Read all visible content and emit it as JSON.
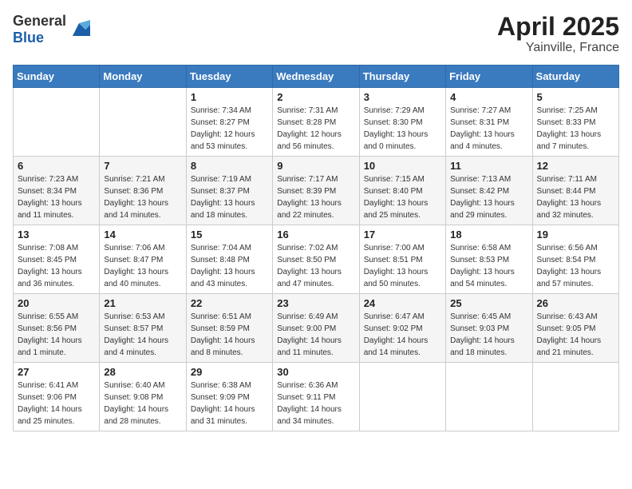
{
  "header": {
    "logo_general": "General",
    "logo_blue": "Blue",
    "month": "April 2025",
    "location": "Yainville, France"
  },
  "calendar": {
    "weekdays": [
      "Sunday",
      "Monday",
      "Tuesday",
      "Wednesday",
      "Thursday",
      "Friday",
      "Saturday"
    ],
    "weeks": [
      [
        {
          "day": "",
          "info": ""
        },
        {
          "day": "",
          "info": ""
        },
        {
          "day": "1",
          "info": "Sunrise: 7:34 AM\nSunset: 8:27 PM\nDaylight: 12 hours and 53 minutes."
        },
        {
          "day": "2",
          "info": "Sunrise: 7:31 AM\nSunset: 8:28 PM\nDaylight: 12 hours and 56 minutes."
        },
        {
          "day": "3",
          "info": "Sunrise: 7:29 AM\nSunset: 8:30 PM\nDaylight: 13 hours and 0 minutes."
        },
        {
          "day": "4",
          "info": "Sunrise: 7:27 AM\nSunset: 8:31 PM\nDaylight: 13 hours and 4 minutes."
        },
        {
          "day": "5",
          "info": "Sunrise: 7:25 AM\nSunset: 8:33 PM\nDaylight: 13 hours and 7 minutes."
        }
      ],
      [
        {
          "day": "6",
          "info": "Sunrise: 7:23 AM\nSunset: 8:34 PM\nDaylight: 13 hours and 11 minutes."
        },
        {
          "day": "7",
          "info": "Sunrise: 7:21 AM\nSunset: 8:36 PM\nDaylight: 13 hours and 14 minutes."
        },
        {
          "day": "8",
          "info": "Sunrise: 7:19 AM\nSunset: 8:37 PM\nDaylight: 13 hours and 18 minutes."
        },
        {
          "day": "9",
          "info": "Sunrise: 7:17 AM\nSunset: 8:39 PM\nDaylight: 13 hours and 22 minutes."
        },
        {
          "day": "10",
          "info": "Sunrise: 7:15 AM\nSunset: 8:40 PM\nDaylight: 13 hours and 25 minutes."
        },
        {
          "day": "11",
          "info": "Sunrise: 7:13 AM\nSunset: 8:42 PM\nDaylight: 13 hours and 29 minutes."
        },
        {
          "day": "12",
          "info": "Sunrise: 7:11 AM\nSunset: 8:44 PM\nDaylight: 13 hours and 32 minutes."
        }
      ],
      [
        {
          "day": "13",
          "info": "Sunrise: 7:08 AM\nSunset: 8:45 PM\nDaylight: 13 hours and 36 minutes."
        },
        {
          "day": "14",
          "info": "Sunrise: 7:06 AM\nSunset: 8:47 PM\nDaylight: 13 hours and 40 minutes."
        },
        {
          "day": "15",
          "info": "Sunrise: 7:04 AM\nSunset: 8:48 PM\nDaylight: 13 hours and 43 minutes."
        },
        {
          "day": "16",
          "info": "Sunrise: 7:02 AM\nSunset: 8:50 PM\nDaylight: 13 hours and 47 minutes."
        },
        {
          "day": "17",
          "info": "Sunrise: 7:00 AM\nSunset: 8:51 PM\nDaylight: 13 hours and 50 minutes."
        },
        {
          "day": "18",
          "info": "Sunrise: 6:58 AM\nSunset: 8:53 PM\nDaylight: 13 hours and 54 minutes."
        },
        {
          "day": "19",
          "info": "Sunrise: 6:56 AM\nSunset: 8:54 PM\nDaylight: 13 hours and 57 minutes."
        }
      ],
      [
        {
          "day": "20",
          "info": "Sunrise: 6:55 AM\nSunset: 8:56 PM\nDaylight: 14 hours and 1 minute."
        },
        {
          "day": "21",
          "info": "Sunrise: 6:53 AM\nSunset: 8:57 PM\nDaylight: 14 hours and 4 minutes."
        },
        {
          "day": "22",
          "info": "Sunrise: 6:51 AM\nSunset: 8:59 PM\nDaylight: 14 hours and 8 minutes."
        },
        {
          "day": "23",
          "info": "Sunrise: 6:49 AM\nSunset: 9:00 PM\nDaylight: 14 hours and 11 minutes."
        },
        {
          "day": "24",
          "info": "Sunrise: 6:47 AM\nSunset: 9:02 PM\nDaylight: 14 hours and 14 minutes."
        },
        {
          "day": "25",
          "info": "Sunrise: 6:45 AM\nSunset: 9:03 PM\nDaylight: 14 hours and 18 minutes."
        },
        {
          "day": "26",
          "info": "Sunrise: 6:43 AM\nSunset: 9:05 PM\nDaylight: 14 hours and 21 minutes."
        }
      ],
      [
        {
          "day": "27",
          "info": "Sunrise: 6:41 AM\nSunset: 9:06 PM\nDaylight: 14 hours and 25 minutes."
        },
        {
          "day": "28",
          "info": "Sunrise: 6:40 AM\nSunset: 9:08 PM\nDaylight: 14 hours and 28 minutes."
        },
        {
          "day": "29",
          "info": "Sunrise: 6:38 AM\nSunset: 9:09 PM\nDaylight: 14 hours and 31 minutes."
        },
        {
          "day": "30",
          "info": "Sunrise: 6:36 AM\nSunset: 9:11 PM\nDaylight: 14 hours and 34 minutes."
        },
        {
          "day": "",
          "info": ""
        },
        {
          "day": "",
          "info": ""
        },
        {
          "day": "",
          "info": ""
        }
      ]
    ]
  }
}
